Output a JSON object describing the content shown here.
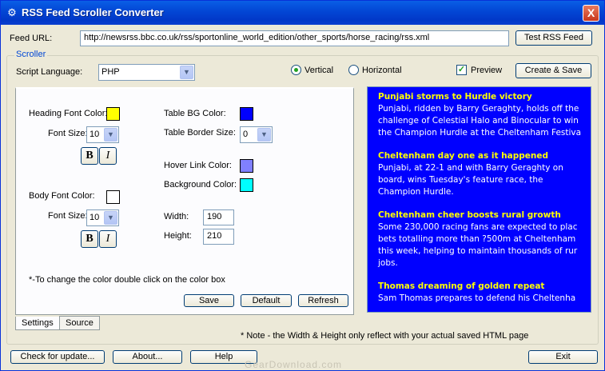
{
  "window": {
    "title": "RSS Feed Scroller Converter",
    "close_glyph": "X"
  },
  "feed": {
    "label": "Feed URL:",
    "url": "http://newsrss.bbc.co.uk/rss/sportonline_world_edition/other_sports/horse_racing/rss.xml",
    "test_button": "Test RSS Feed"
  },
  "scroller": {
    "group_label": "Scroller",
    "language_label": "Script Language:",
    "language_value": "PHP",
    "orientation_vertical": "Vertical",
    "orientation_horizontal": "Horizontal",
    "vertical_selected": true,
    "preview_label": "Preview",
    "preview_checked": true,
    "create_save_button": "Create & Save"
  },
  "settings": {
    "heading_font_color_label": "Heading Font Color:",
    "heading_font_color": "#ffff00",
    "heading_font_size_label": "Font Size:",
    "heading_font_size": "10",
    "body_font_color_label": "Body Font Color:",
    "body_font_color": "#ffffff",
    "body_font_size_label": "Font Size:",
    "body_font_size": "10",
    "bold_label": "B",
    "italic_label": "I",
    "table_bg_color_label": "Table BG Color:",
    "table_bg_color": "#0000ff",
    "table_border_size_label": "Table Border Size:",
    "table_border_size": "0",
    "hover_link_color_label": "Hover Link Color:",
    "hover_link_color": "#8080ff",
    "background_color_label": "Background Color:",
    "background_color": "#00ffff",
    "width_label": "Width:",
    "width_value": "190",
    "height_label": "Height:",
    "height_value": "210",
    "hint": "*-To change the color double click on the color box",
    "save_button": "Save",
    "default_button": "Default",
    "refresh_button": "Refresh"
  },
  "tabs": [
    "Settings",
    "Source"
  ],
  "note": "* Note - the Width & Height only reflect with your actual saved HTML page",
  "news": [
    {
      "headline": "Punjabi storms to Hurdle victory",
      "lines": [
        "Punjabi, ridden by Barry Geraghty, holds off the",
        "challenge of Celestial Halo and Binocular to win",
        "the Champion Hurdle at the Cheltenham Festiva"
      ]
    },
    {
      "headline": "Cheltenham day one as it happened",
      "lines": [
        "Punjabi, at 22-1 and with Barry Geraghty on",
        "board, wins Tuesday's feature race, the",
        "Champion Hurdle."
      ]
    },
    {
      "headline": "Cheltenham cheer boosts rural growth",
      "lines": [
        "Some 230,000 racing fans are expected to plac",
        "bets totalling more than ?500m at Cheltenham",
        "this week, helping to maintain thousands of rur",
        "jobs."
      ]
    },
    {
      "headline": "Thomas dreaming of golden repeat",
      "lines": [
        "Sam Thomas prepares to defend his Cheltenha"
      ]
    }
  ],
  "footer": {
    "check_update": "Check for update...",
    "about": "About...",
    "help": "Help",
    "exit": "Exit"
  },
  "watermark": "GearDownload.com"
}
